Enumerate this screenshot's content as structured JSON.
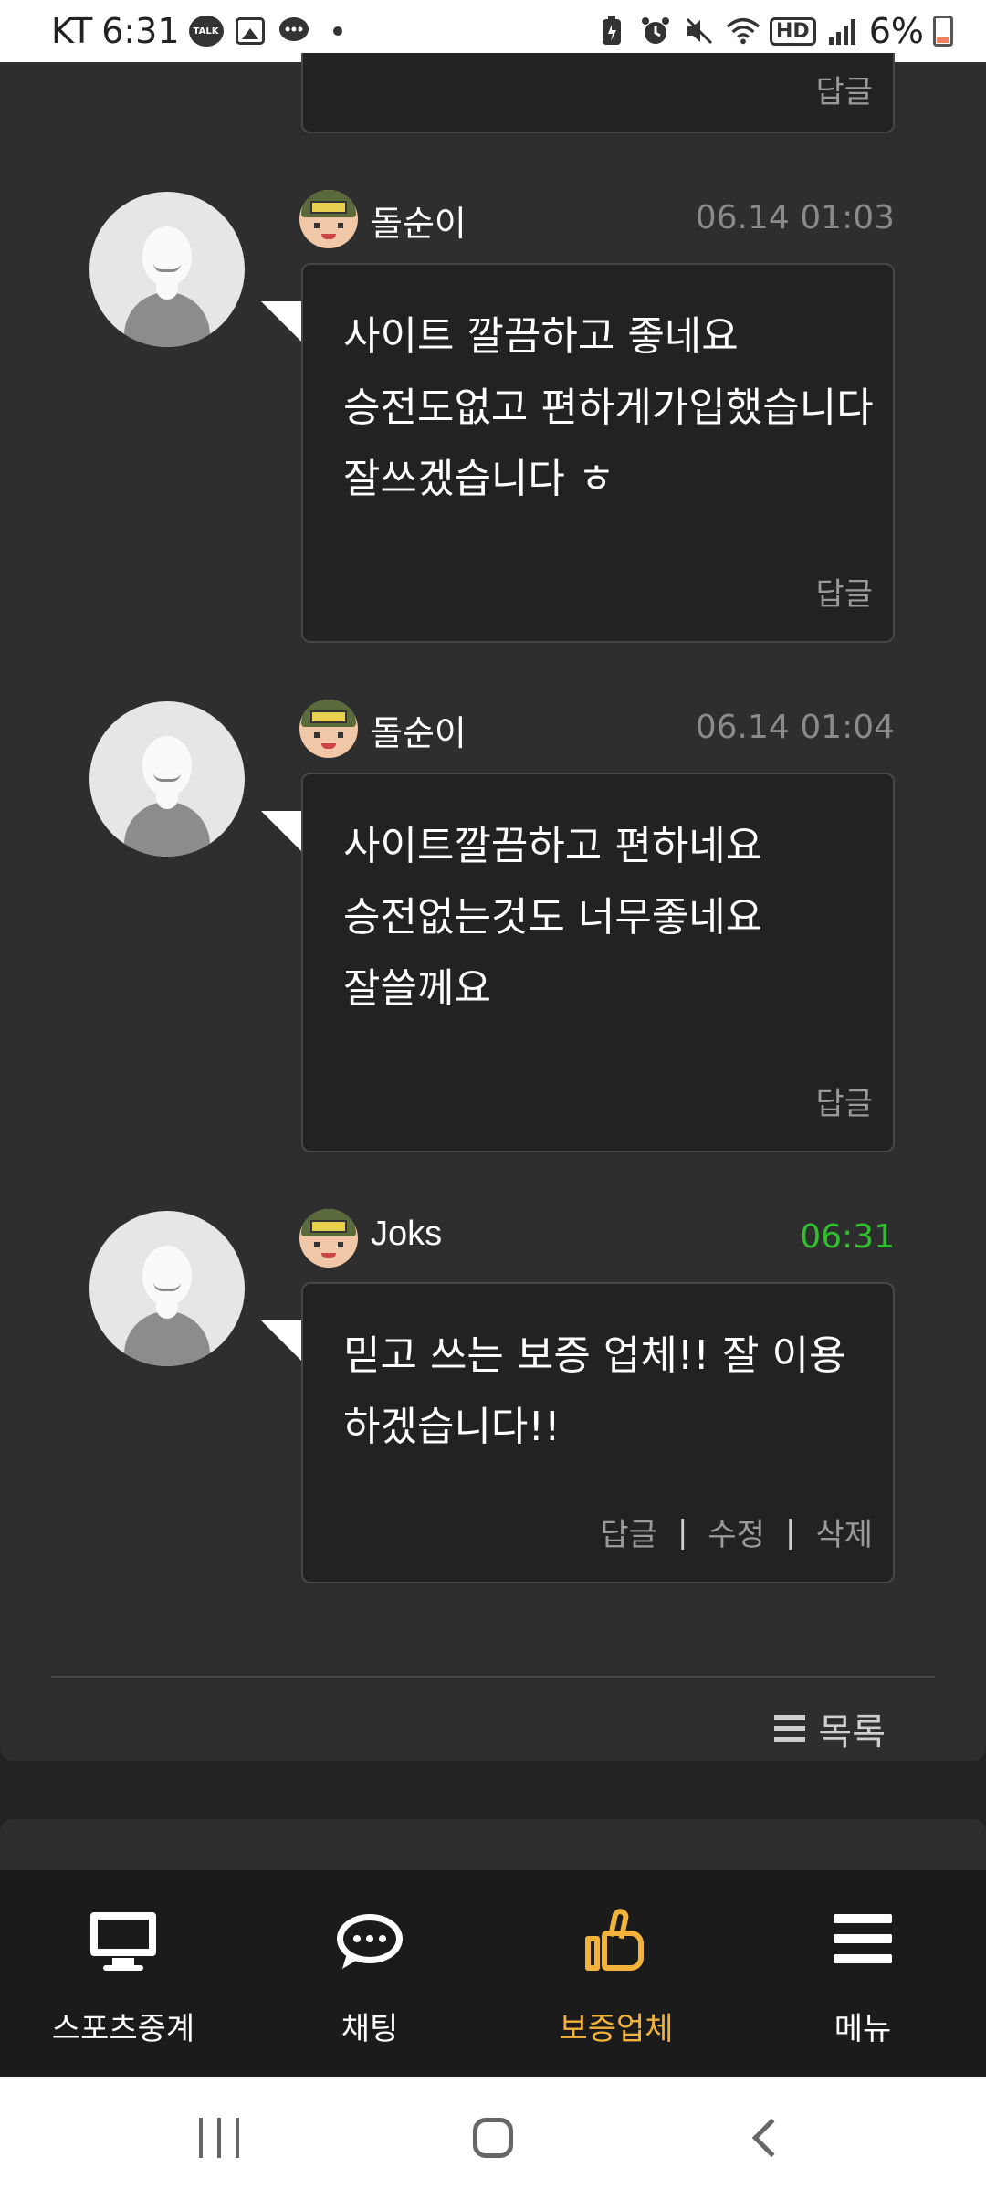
{
  "status_bar": {
    "carrier": "KT",
    "time": "6:31",
    "notification_icons": [
      "kakaotalk-icon",
      "gallery-icon",
      "message-icon",
      "dot-icon"
    ],
    "system_icons": [
      "battery-saver-icon",
      "alarm-icon",
      "mute-icon",
      "wifi-icon",
      "hd-icon",
      "signal-icon"
    ],
    "battery_percent": "6%",
    "hd_label": "HD"
  },
  "comments": [
    {
      "partial": true,
      "actions": [
        "답글"
      ]
    },
    {
      "author": "돌순이",
      "time": "06.14 01:03",
      "lines": [
        "사이트 깔끔하고 좋네요",
        "승전도없고 편하게가입했습니다",
        "잘쓰겠습니다 ㅎ"
      ],
      "actions": [
        "답글"
      ]
    },
    {
      "author": "돌순이",
      "time": "06.14 01:04",
      "lines": [
        "사이트깔끔하고 편하네요",
        "승전없는것도 너무좋네요",
        "잘쓸께요"
      ],
      "actions": [
        "답글"
      ]
    },
    {
      "author": "Joks",
      "time": "06:31",
      "lines": [
        "믿고 쓰는 보증 업체!! 잘 이용",
        "하겠습니다!!"
      ],
      "actions": [
        "답글",
        "수정",
        "삭제"
      ],
      "separator": "|"
    }
  ],
  "list_button": {
    "label": "목록",
    "icon": "list-icon"
  },
  "bottom_nav": [
    {
      "label": "스포츠중계",
      "icon": "monitor-icon",
      "active": false
    },
    {
      "label": "채팅",
      "icon": "chat-bubble-icon",
      "active": false
    },
    {
      "label": "보증업체",
      "icon": "thumbs-up-icon",
      "active": true
    },
    {
      "label": "메뉴",
      "icon": "hamburger-menu-icon",
      "active": false
    }
  ],
  "colors": {
    "accent": "#f2b33c",
    "recent_time": "#2fbf2f",
    "background": "#222222",
    "card": "#2e2e2e"
  }
}
